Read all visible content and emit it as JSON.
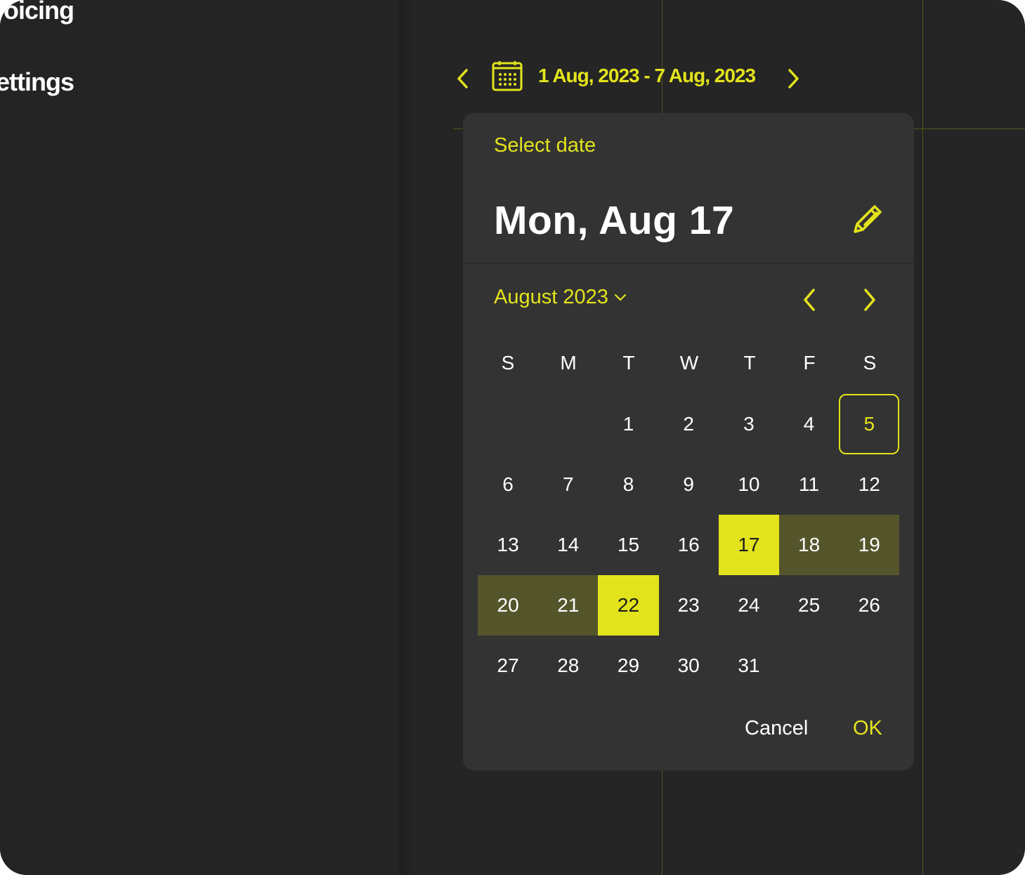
{
  "sidebar": {
    "items": [
      {
        "label": "voicing"
      },
      {
        "label": "ettings"
      }
    ]
  },
  "date_range": {
    "text": "1 Aug, 2023 - 7 Aug, 2023"
  },
  "picker": {
    "label": "Select date",
    "headline": "Mon, Aug 17",
    "month": "August 2023",
    "weekdays": [
      "S",
      "M",
      "T",
      "W",
      "T",
      "F",
      "S"
    ],
    "first_weekday_index": 2,
    "days_in_month": 31,
    "today": 5,
    "selected_start": 17,
    "selected_end": 22,
    "cancel_label": "Cancel",
    "ok_label": "OK"
  },
  "colors": {
    "accent": "#e3e31d",
    "range_fill": "#55552c",
    "background": "#252525",
    "dialog": "#333333"
  }
}
